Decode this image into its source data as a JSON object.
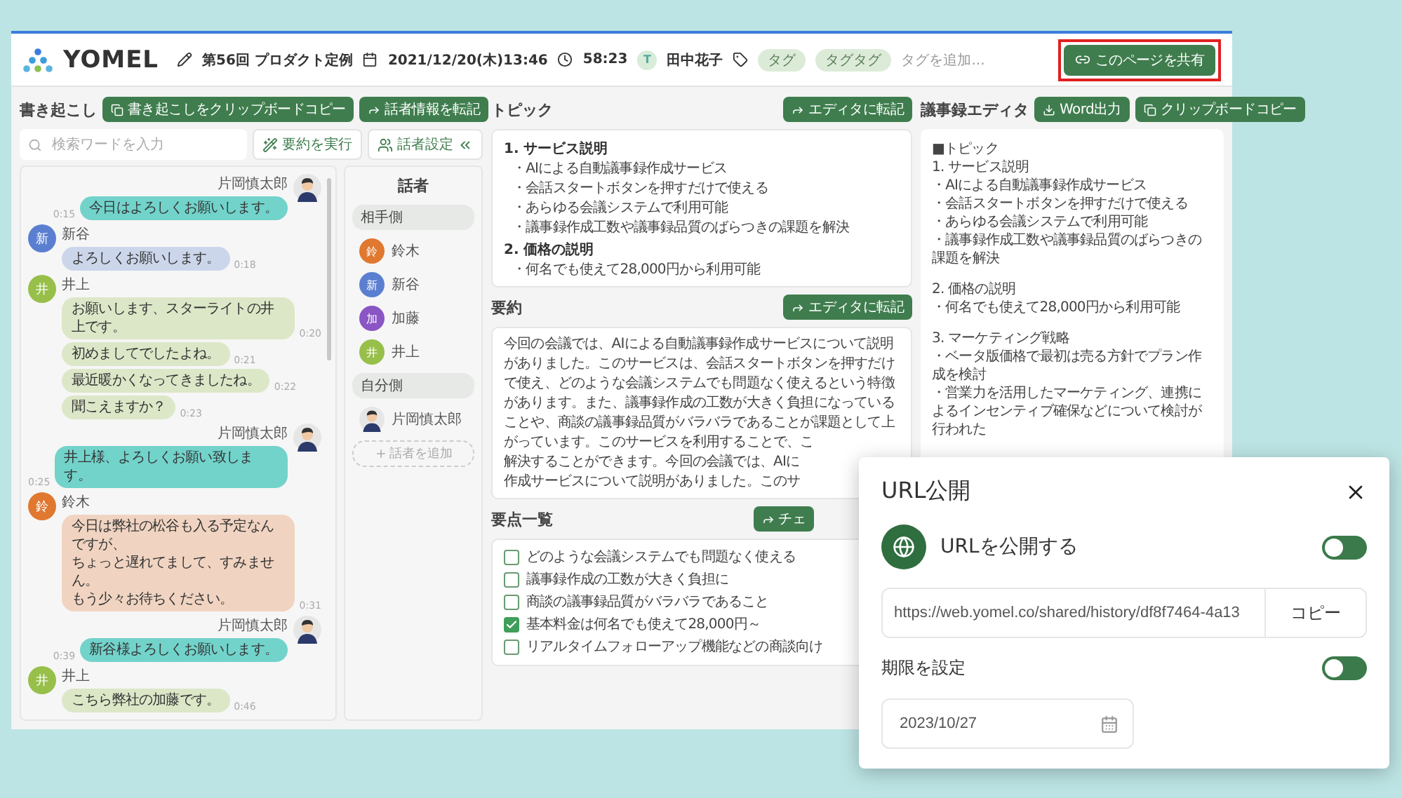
{
  "header": {
    "logo": "YOMEL",
    "meeting_title": "第56回 プロダクト定例",
    "datetime": "2021/12/20(木)13:46",
    "duration": "58:23",
    "owner_initial": "T",
    "owner": "田中花子",
    "tags": [
      "タグ",
      "タグタグ"
    ],
    "tag_placeholder": "タグを追加...",
    "share_button": "このページを共有"
  },
  "transcript": {
    "title": "書き起こし",
    "copy_button": "書き起こしをクリップボードコピー",
    "transfer_button": "話者情報を転記",
    "search": {
      "placeholder": "検索ワードを入力"
    },
    "summarize_button": "要約を実行",
    "speaker_settings_button": "話者設定",
    "messages": [
      {
        "kind": "self",
        "speaker": "片岡慎太郎",
        "lines": [
          {
            "text": "今日はよろしくお願いします。",
            "time": "0:15"
          }
        ]
      },
      {
        "kind": "other",
        "speaker": "新谷",
        "initial": "新",
        "color": "#5b7fd0",
        "lines": [
          {
            "text": "よろしくお願いします。",
            "time": "0:18"
          }
        ]
      },
      {
        "kind": "other",
        "speaker": "井上",
        "initial": "井",
        "color": "#97bf4a",
        "lines": [
          {
            "text": "お願いします、スターライトの井上です。",
            "time": "0:20"
          },
          {
            "text": "初めましてでしたよね。",
            "time": "0:21"
          },
          {
            "text": "最近暖かくなってきましたね。",
            "time": "0:22"
          },
          {
            "text": "聞こえますか？",
            "time": "0:23"
          }
        ]
      },
      {
        "kind": "self",
        "speaker": "片岡慎太郎",
        "lines": [
          {
            "text": "井上様、よろしくお願い致します。",
            "time": "0:25"
          }
        ]
      },
      {
        "kind": "other",
        "speaker": "鈴木",
        "initial": "鈴",
        "color": "#e0782f",
        "lines": [
          {
            "text_lines": [
              "今日は弊社の松谷も入る予定なんですが、",
              "ちょっと遅れてまして、すみません。",
              "もう少々お待ちください。"
            ],
            "time": "0:31"
          }
        ]
      },
      {
        "kind": "self",
        "speaker": "片岡慎太郎",
        "lines": [
          {
            "text": "新谷様よろしくお願いします。",
            "time": "0:39"
          }
        ]
      },
      {
        "kind": "other",
        "speaker": "井上",
        "initial": "井",
        "color": "#97bf4a",
        "lines": [
          {
            "text": "こちら弊社の加藤です。",
            "time": "0:46"
          }
        ]
      }
    ],
    "speakers": {
      "title": "話者",
      "groups": [
        {
          "label": "相手側",
          "speakers": [
            {
              "kind": "initial",
              "initial": "鈴",
              "name": "鈴木",
              "color": "#e0782f"
            },
            {
              "kind": "initial",
              "initial": "新",
              "name": "新谷",
              "color": "#5b7fd0"
            },
            {
              "kind": "initial",
              "initial": "加",
              "name": "加藤",
              "color": "#8a55c4"
            },
            {
              "kind": "initial",
              "initial": "井",
              "name": "井上",
              "color": "#97bf4a"
            }
          ]
        },
        {
          "label": "自分側",
          "speakers": [
            {
              "kind": "figure",
              "name": "片岡慎太郎"
            }
          ]
        }
      ],
      "add_button": "話者を追加"
    }
  },
  "topic": {
    "title": "トピック",
    "button": "エディタに転記",
    "sections": [
      {
        "heading": "1. サービス説明",
        "bullets": [
          "・AIによる自動議事録作成サービス",
          "・会話スタートボタンを押すだけで使える",
          "・あらゆる会議システムで利用可能",
          "・議事録作成工数や議事録品質のばらつきの課題を解決"
        ]
      },
      {
        "heading": "2. 価格の説明",
        "bullets": [
          "・何名でも使えて28,000円から利用可能"
        ]
      }
    ]
  },
  "summary": {
    "title": "要約",
    "button": "エディタに転記",
    "lines": [
      "今回の会議では、AIによる自動議事録作成サービスについて説明",
      "がありました。このサービスは、会話スタートボタンを押すだけ",
      "で使え、どのような会議システムでも問題なく使えるという特徴",
      "があります。また、議事録作成の工数が大きく負担になっている",
      "ことや、商談の議事録品質がバラバラであることが課題として上",
      "がっています。このサービスを利用することで、こ",
      "解決することができます。今回の会議では、AIに",
      "作成サービスについて説明がありました。このサ"
    ]
  },
  "key_points": {
    "title": "要点一覧",
    "button": "チェ",
    "items": [
      {
        "text": "どのような会議システムでも問題なく使える",
        "checked": false
      },
      {
        "text": "議事録作成の工数が大きく負担に",
        "checked": false
      },
      {
        "text": "商談の議事録品質がバラバラであること",
        "checked": false
      },
      {
        "text": "基本料金は何名でも使えて28,000円～",
        "checked": true
      },
      {
        "text": "リアルタイムフォローアップ機能などの商談向け",
        "checked": false
      }
    ]
  },
  "editor": {
    "title": "議事録エディタ",
    "word_button": "Word出力",
    "copy_button": "クリップボードコピー",
    "blocks": [
      [
        "■トピック",
        "1. サービス説明",
        "・AIによる自動議事録作成サービス",
        "・会話スタートボタンを押すだけで使える",
        "・あらゆる会議システムで利用可能",
        "・議事録作成工数や議事録品質のばらつきの課題を解決"
      ],
      [
        "2. 価格の説明",
        "・何名でも使えて28,000円から利用可能"
      ],
      [
        "3. マーケティング戦略",
        "・ベータ版価格で最初は売る方針でプラン作成を検討",
        "・営業力を活用したマーケティング、連携によるインセンティブ確保などについて検討が行われた"
      ]
    ]
  },
  "dialog": {
    "title": "URL公開",
    "publish": {
      "label": "URLを公開する",
      "on": false
    },
    "url": "https://web.yomel.co/shared/history/df8f7464-4a13",
    "copy_button": "コピー",
    "deadline": {
      "label": "期限を設定",
      "on": false
    },
    "date": "2023/10/27"
  }
}
